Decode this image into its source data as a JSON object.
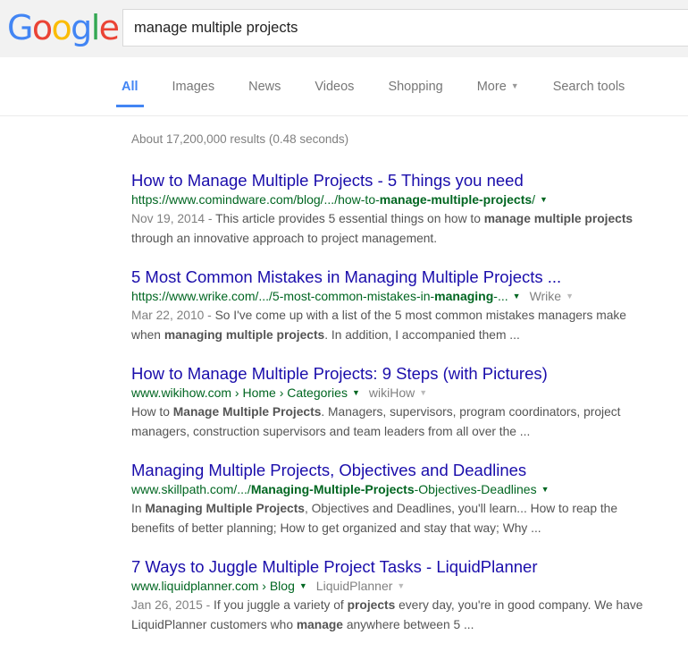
{
  "header": {
    "logo": {
      "name": "google-logo",
      "letters": [
        {
          "char": "G",
          "color": "#4285f4"
        },
        {
          "char": "o",
          "color": "#ea4335"
        },
        {
          "char": "o",
          "color": "#fbbc05"
        },
        {
          "char": "g",
          "color": "#4285f4"
        },
        {
          "char": "l",
          "color": "#34a853"
        },
        {
          "char": "e",
          "color": "#ea4335"
        }
      ]
    },
    "search": {
      "value": "manage multiple projects",
      "placeholder": "Search"
    }
  },
  "nav": {
    "tabs": [
      {
        "label": "All",
        "active": true,
        "caret": false
      },
      {
        "label": "Images",
        "active": false,
        "caret": false
      },
      {
        "label": "News",
        "active": false,
        "caret": false
      },
      {
        "label": "Videos",
        "active": false,
        "caret": false
      },
      {
        "label": "Shopping",
        "active": false,
        "caret": false
      },
      {
        "label": "More",
        "active": false,
        "caret": true
      },
      {
        "label": "Search tools",
        "active": false,
        "caret": false
      }
    ],
    "active_color": "#4285f4"
  },
  "results_meta": {
    "stats": "About 17,200,000 results (0.48 seconds)"
  },
  "results": [
    {
      "title": "How to Manage Multiple Projects - 5 Things you need",
      "url_prefix": "https://www.comindware.com/blog/.../how-to-",
      "url_bold": "manage-multiple-projects",
      "url_suffix": "/",
      "sitename": "",
      "snippet_date": "Nov 19, 2014 - ",
      "snippet_parts": [
        {
          "text": "This article provides 5 essential things on how to ",
          "bold": false
        },
        {
          "text": "manage multiple projects",
          "bold": true
        },
        {
          "text": " through an innovative approach to project management.",
          "bold": false
        }
      ]
    },
    {
      "title": "5 Most Common Mistakes in Managing Multiple Projects ...",
      "url_prefix": "https://www.wrike.com/.../5-most-common-mistakes-in-",
      "url_bold": "managing",
      "url_suffix": "-...",
      "sitename": "Wrike",
      "snippet_date": "Mar 22, 2010 - ",
      "snippet_parts": [
        {
          "text": "So I've come up with a list of the 5 most common mistakes managers make when ",
          "bold": false
        },
        {
          "text": "managing multiple projects",
          "bold": true
        },
        {
          "text": ". In addition, I accompanied them ...",
          "bold": false
        }
      ]
    },
    {
      "title": "How to Manage Multiple Projects: 9 Steps (with Pictures)",
      "url_prefix": "www.wikihow.com › Home › Categories",
      "url_bold": "",
      "url_suffix": "",
      "sitename": "wikiHow",
      "snippet_date": "",
      "snippet_parts": [
        {
          "text": "How to ",
          "bold": false
        },
        {
          "text": "Manage Multiple Projects",
          "bold": true
        },
        {
          "text": ". Managers, supervisors, program coordinators, project managers, construction supervisors and team leaders from all over the ...",
          "bold": false
        }
      ]
    },
    {
      "title": "Managing Multiple Projects, Objectives and Deadlines",
      "url_prefix": "www.skillpath.com/.../",
      "url_bold": "Managing-Multiple-Projects",
      "url_suffix": "-Objectives-Deadlines",
      "sitename": "",
      "snippet_date": "",
      "snippet_parts": [
        {
          "text": "In ",
          "bold": false
        },
        {
          "text": "Managing Multiple Projects",
          "bold": true
        },
        {
          "text": ", Objectives and Deadlines, you'll learn... How to reap the benefits of better planning; How to get organized and stay that way; Why ...",
          "bold": false
        }
      ]
    },
    {
      "title": "7 Ways to Juggle Multiple Project Tasks - LiquidPlanner",
      "url_prefix": "www.liquidplanner.com › Blog",
      "url_bold": "",
      "url_suffix": "",
      "sitename": "LiquidPlanner",
      "snippet_date": "Jan 26, 2015 - ",
      "snippet_parts": [
        {
          "text": "If you juggle a variety of ",
          "bold": false
        },
        {
          "text": "projects",
          "bold": true
        },
        {
          "text": " every day, you're in good company. We have LiquidPlanner customers who ",
          "bold": false
        },
        {
          "text": "manage",
          "bold": true
        },
        {
          "text": " anywhere between 5  ...",
          "bold": false
        }
      ]
    }
  ],
  "icons": {
    "caret_down": "▼"
  },
  "colors": {
    "link": "#1a0dab",
    "url_green": "#006621",
    "snippet": "#545454",
    "muted": "#808080",
    "header_bg": "#f2f2f2",
    "accent_blue": "#4285f4"
  }
}
